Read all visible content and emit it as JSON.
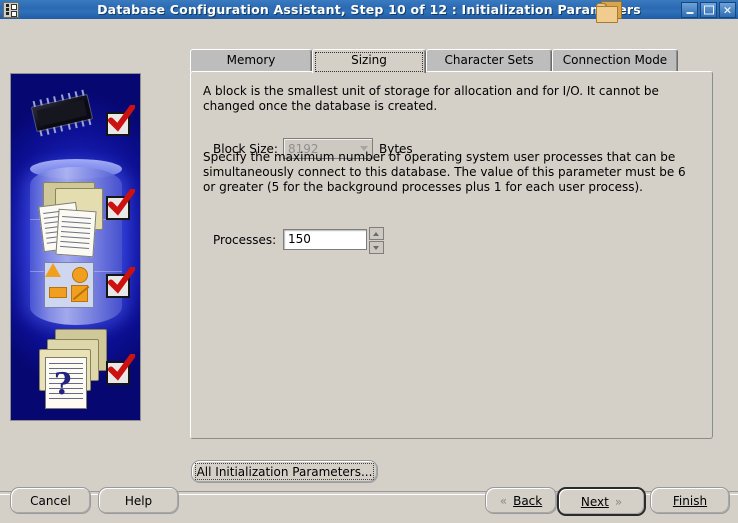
{
  "window": {
    "title": "Database Configuration Assistant, Step 10 of 12 : Initialization Parameters",
    "app_icon": "database-icon",
    "overlay_icon": "folder-icon",
    "minimize_label": "",
    "maximize_label": "",
    "close_label": "×"
  },
  "tabs": [
    {
      "label": "Memory",
      "selected": false
    },
    {
      "label": "Sizing",
      "selected": true
    },
    {
      "label": "Character Sets",
      "selected": false
    },
    {
      "label": "Connection Mode",
      "selected": false
    }
  ],
  "panel": {
    "block_paragraph": "A block is the smallest unit of storage for allocation and for I/O. It cannot be changed once the database is created.",
    "block_size_label": "Block Size:",
    "block_size_value": "8192",
    "block_size_enabled": "disabled",
    "bytes_label": "Bytes",
    "processes_paragraph": "Specify the maximum number of operating system user processes that can be simultaneously connect to this database. The value of this parameter must be 6 or greater (5 for the background processes plus 1 for each user process).",
    "processes_label": "Processes:",
    "processes_value": "150"
  },
  "buttons": {
    "all_parameters": "All Initialization Parameters...",
    "cancel": "Cancel",
    "help": "Help",
    "back": "Back",
    "next": "Next",
    "finish": "Finish",
    "back_chevron": "«",
    "next_chevron": "»"
  },
  "sidebar": {
    "graphic": "oracle-database-illustration",
    "checkmarks": 4
  },
  "colors": {
    "titlebar": "#2b6ab3",
    "face": "#d4d0c8",
    "sidebar_blue": "#0c0f92",
    "accent_orange": "#f0a01e",
    "check_red": "#cc1111"
  }
}
